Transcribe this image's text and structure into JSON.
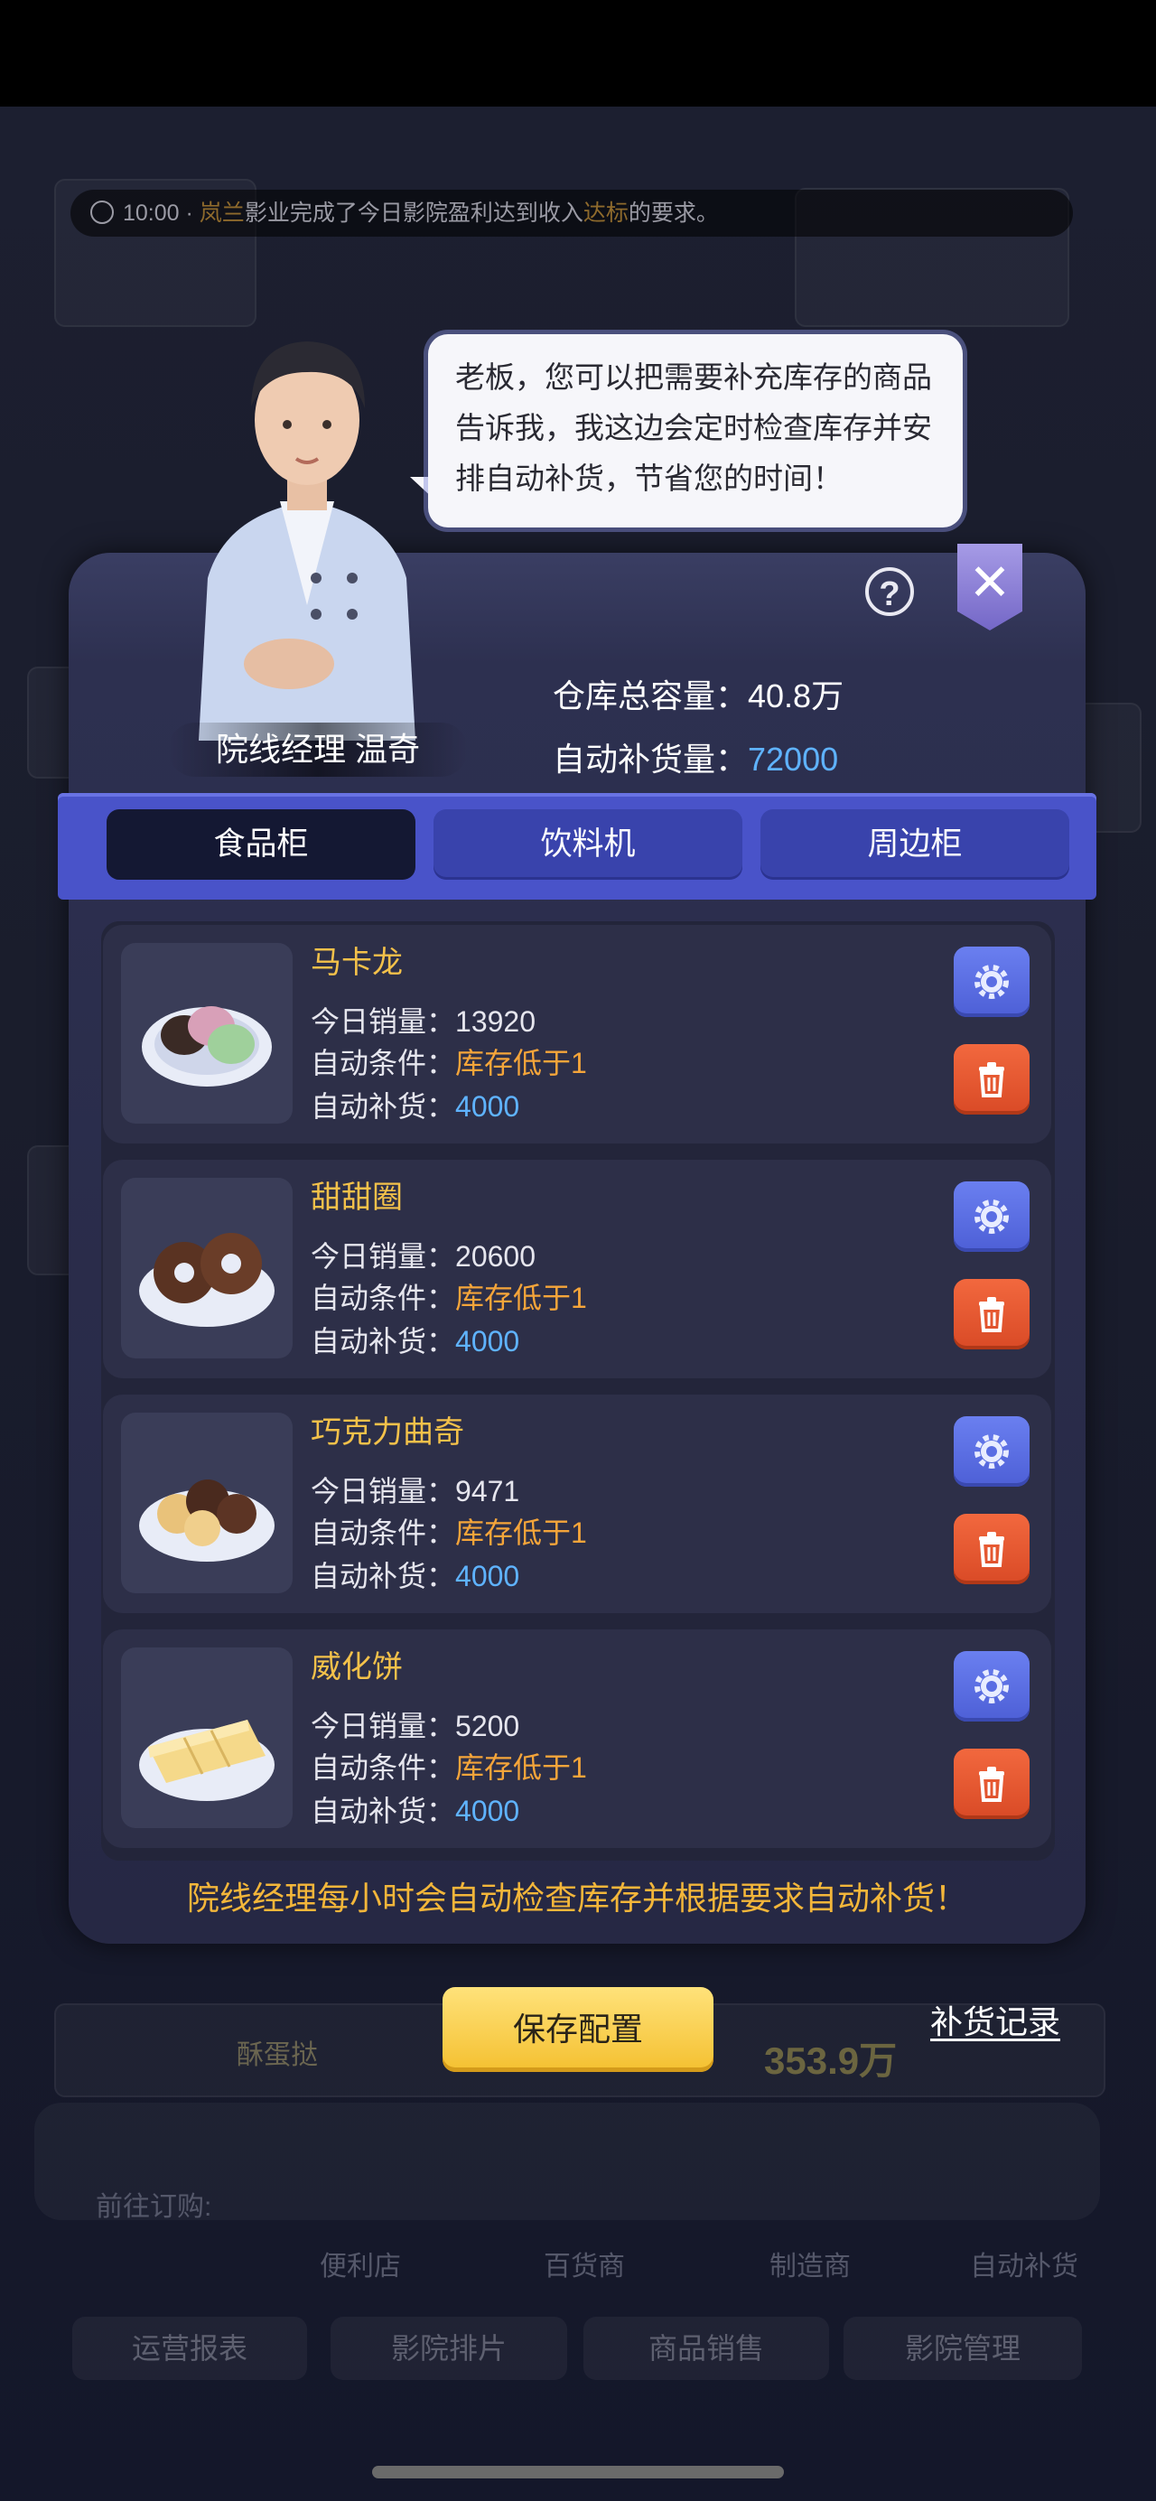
{
  "ticker": {
    "time": "10:00",
    "sep": "·",
    "company": "岚兰",
    "text_a": "影业完成了今日影院盈利达到收入",
    "highlight": "达标",
    "text_b": "的要求。"
  },
  "background": {
    "side_name_a": "",
    "side_label": "酥蛋挞",
    "side_amount": "353.9万",
    "goto_label": "前往订购:",
    "shops": [
      "便利店",
      "百货商",
      "制造商",
      "自动补货"
    ],
    "nav_tabs": [
      "运营报表",
      "影院排片",
      "商品销售",
      "影院管理"
    ]
  },
  "bubble": {
    "text": "老板，您可以把需要补充库存的商品告诉我，我这边会定时检查库存并安排自动补货，节省您的时间！"
  },
  "manager": {
    "name": "院线经理 温奇"
  },
  "stats": {
    "capacity_label": "仓库总容量：",
    "capacity_value": "40.8万",
    "auto_label": "自动补货量：",
    "auto_value": "72000"
  },
  "tabs": [
    {
      "label": "食品柜",
      "active": true
    },
    {
      "label": "饮料机",
      "active": false
    },
    {
      "label": "周边柜",
      "active": false
    }
  ],
  "items": [
    {
      "name": "马卡龙",
      "sales_label": "今日销量：",
      "sales": "13920",
      "cond_label": "自动条件：",
      "cond": "库存低于1",
      "refill_label": "自动补货：",
      "refill": "4000"
    },
    {
      "name": "甜甜圈",
      "sales_label": "今日销量：",
      "sales": "20600",
      "cond_label": "自动条件：",
      "cond": "库存低于1",
      "refill_label": "自动补货：",
      "refill": "4000"
    },
    {
      "name": "巧克力曲奇",
      "sales_label": "今日销量：",
      "sales": "9471",
      "cond_label": "自动条件：",
      "cond": "库存低于1",
      "refill_label": "自动补货：",
      "refill": "4000"
    },
    {
      "name": "威化饼",
      "sales_label": "今日销量：",
      "sales": "5200",
      "cond_label": "自动条件：",
      "cond": "库存低于1",
      "refill_label": "自动补货：",
      "refill": "4000"
    }
  ],
  "footer_note": "院线经理每小时会自动检查库存并根据要求自动补货！",
  "save_button": "保存配置",
  "record_link": "补货记录",
  "colors": {
    "accent_yellow": "#f3c14a",
    "orange": "#f5a53a",
    "blue": "#5fb3ff",
    "tab_bar": "#4953c9",
    "gear_button": "#5a6de3",
    "trash_button": "#e3552f"
  },
  "icons": [
    "clock-icon",
    "help-icon",
    "close-icon",
    "gear-icon",
    "trash-icon"
  ]
}
